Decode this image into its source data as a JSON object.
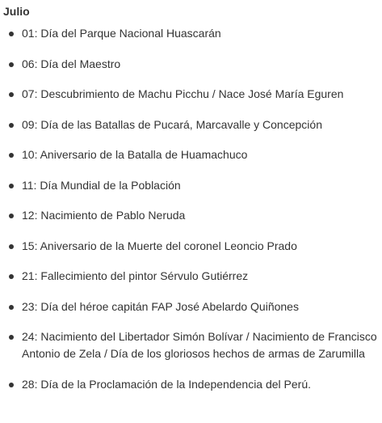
{
  "month": "Julio",
  "items": [
    "01: Día del Parque Nacional Huascarán",
    "06: Día del Maestro",
    "07: Descubrimiento de Machu Picchu / Nace José María Eguren",
    "09: Día de las Batallas de Pucará, Marcavalle y Concepción",
    "10: Aniversario de la Batalla de Huamachuco",
    "11: Día Mundial de la Población",
    "12: Nacimiento de Pablo Neruda",
    "15: Aniversario de la Muerte del coronel Leoncio Prado",
    "21: Fallecimiento del pintor Sérvulo Gutiérrez",
    "23: Día del héroe capitán FAP José Abelardo Quiñones",
    "24: Nacimiento del Libertador Simón Bolívar / Nacimiento de Francisco Antonio de Zela / Día de los gloriosos hechos de armas de Zarumilla",
    "28: Día de la Proclamación de la Independencia del Perú."
  ]
}
